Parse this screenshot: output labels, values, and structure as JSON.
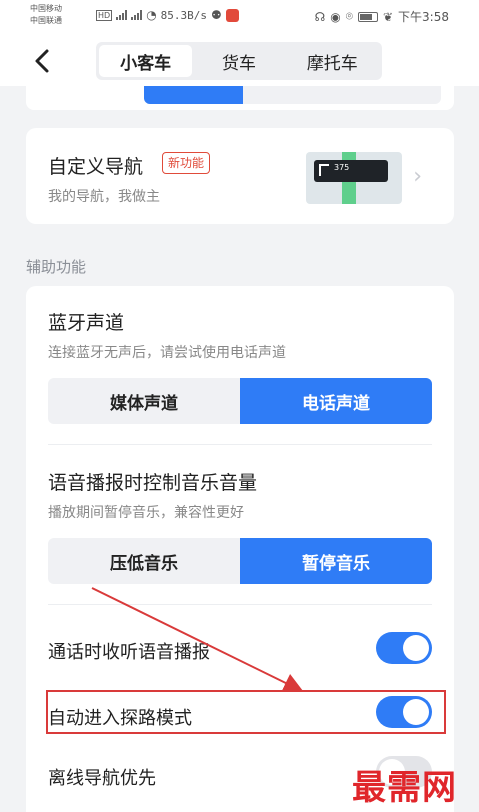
{
  "status_bar": {
    "carrier_1": "中国移动",
    "carrier_2": "中国联通",
    "hd": "HD",
    "net_speed": "85.3B/s",
    "time": "下午3:58"
  },
  "header": {
    "back_icon": "chevron-left-icon",
    "tabs": [
      {
        "label": "小客车",
        "active": true
      },
      {
        "label": "货车",
        "active": false
      },
      {
        "label": "摩托车",
        "active": false
      }
    ]
  },
  "custom_nav": {
    "title": "自定义导航",
    "badge": "新功能",
    "subtitle": "我的导航，我做主",
    "thumb_text": "375"
  },
  "section_label": "辅助功能",
  "bluetooth": {
    "title": "蓝牙声道",
    "subtitle": "连接蓝牙无声后，请尝试使用电话声道",
    "options": [
      "媒体声道",
      "电话声道"
    ],
    "selected": "电话声道"
  },
  "music": {
    "title": "语音播报时控制音乐音量",
    "subtitle": "播放期间暂停音乐，兼容性更好",
    "options": [
      "压低音乐",
      "暂停音乐"
    ],
    "selected": "暂停音乐"
  },
  "toggles": [
    {
      "label": "通话时收听语音播报",
      "on": true
    },
    {
      "label": "自动进入探路模式",
      "on": true
    },
    {
      "label": "离线导航优先",
      "on": false
    }
  ],
  "watermark": "最需网",
  "colors": {
    "accent": "#2f7cf6",
    "highlight": "#d93a3a",
    "watermark": "#e0262b"
  }
}
